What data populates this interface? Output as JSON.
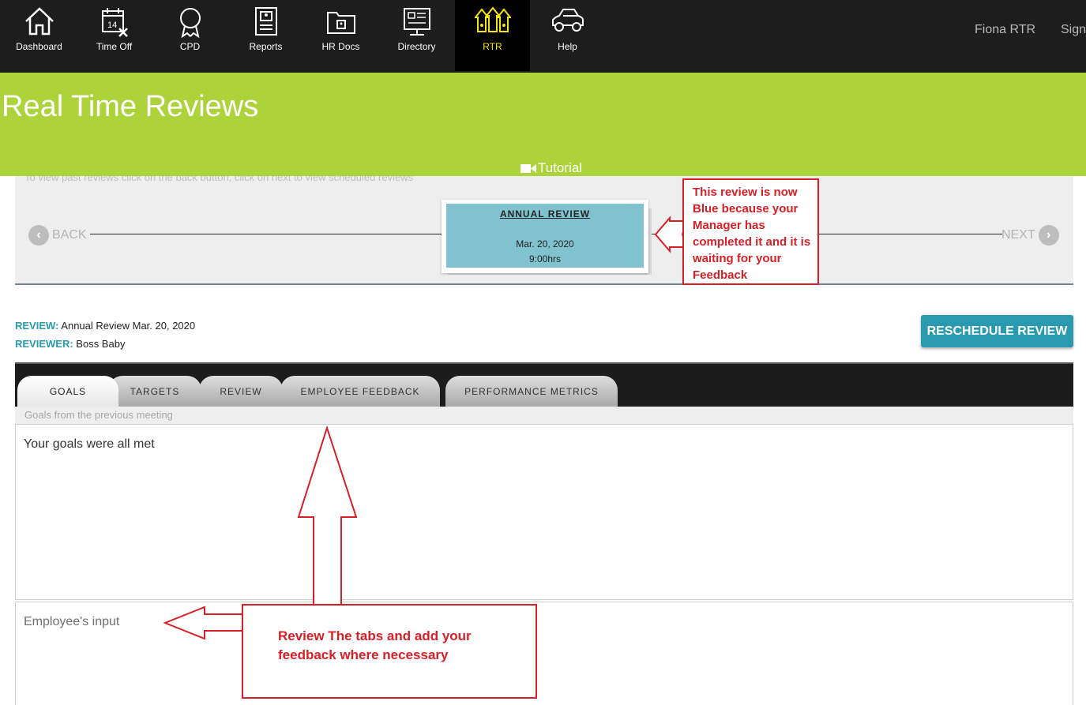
{
  "nav": {
    "items": [
      {
        "label": "Dashboard",
        "icon": "house-icon"
      },
      {
        "label": "Time Off",
        "icon": "calendar-icon"
      },
      {
        "label": "CPD",
        "icon": "award-ribbon-icon"
      },
      {
        "label": "Reports",
        "icon": "report-document-icon"
      },
      {
        "label": "HR Docs",
        "icon": "folder-icon"
      },
      {
        "label": "Directory",
        "icon": "directory-monitor-icon"
      },
      {
        "label": "RTR",
        "icon": "rtr-arrows-icon"
      },
      {
        "label": "Help",
        "icon": "car-icon"
      }
    ],
    "calendar_day": "14",
    "user_name": "Fiona RTR",
    "sign_label": "Sign",
    "active_color": "#f5e313"
  },
  "banner": {
    "title": "Real Time Reviews",
    "tutorial_label": "Tutorial",
    "color": "#acd33a"
  },
  "timeline": {
    "hint": "To view past reviews click on the back button, click on next to view scheduled reviews",
    "back_label": "BACK",
    "next_label": "NEXT",
    "card": {
      "title": "ANNUAL REVIEW",
      "date": "Mar. 20, 2020",
      "time": "9:00hrs",
      "color": "#80c2d0"
    }
  },
  "callouts": {
    "card_note": [
      "This review is now",
      "Blue because your",
      "Manager has",
      "completed it and it is",
      "waiting for your",
      "Feedback"
    ],
    "tabs_note": [
      "Review The tabs and add your",
      "feedback where necessary"
    ],
    "color": "#d62027"
  },
  "review": {
    "review_label": "REVIEW:",
    "review_value": "Annual Review Mar. 20, 2020",
    "reviewer_label": "REVIEWER:",
    "reviewer_value": "Boss Baby",
    "reschedule_label": "RESCHEDULE REVIEW",
    "accent": "#2a9ab0"
  },
  "tabs": [
    {
      "label": "GOALS",
      "active": true
    },
    {
      "label": "TARGETS",
      "active": false
    },
    {
      "label": "REVIEW",
      "active": false
    },
    {
      "label": "EMPLOYEE FEEDBACK",
      "active": false
    },
    {
      "label": "PERFORMANCE METRICS",
      "active": false
    }
  ],
  "goals": {
    "subtitle": "Goals from the previous meeting",
    "text": "Your goals were all met",
    "employee_input_placeholder": "Employee's input"
  }
}
